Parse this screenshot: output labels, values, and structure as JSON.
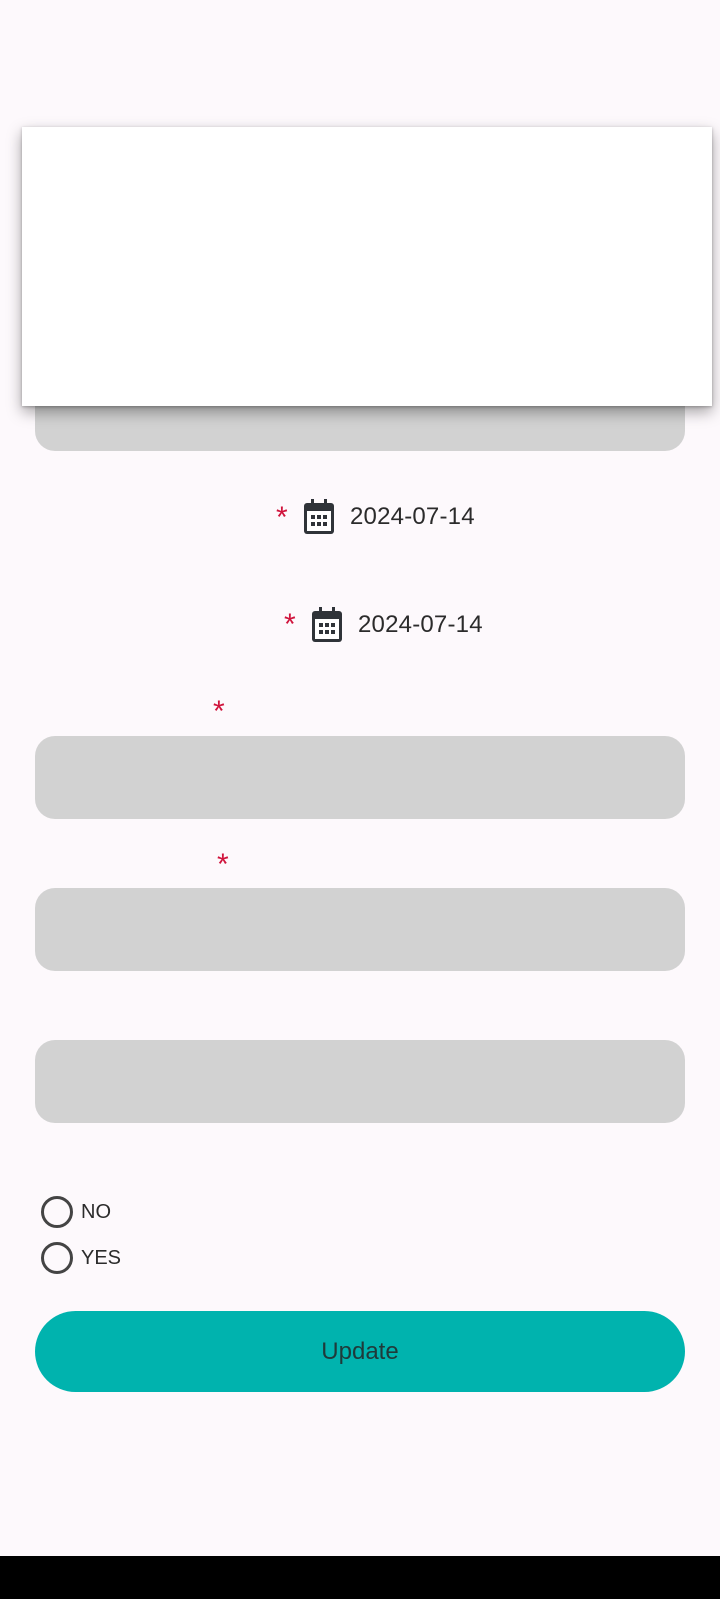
{
  "form": {
    "date_1": {
      "value": "2024-07-14",
      "required_mark": "*"
    },
    "date_2": {
      "value": "2024-07-14",
      "required_mark": "*"
    },
    "field_1": {
      "required_mark": "*"
    },
    "field_2": {
      "required_mark": "*"
    },
    "radio_options": [
      {
        "label": "NO"
      },
      {
        "label": "YES"
      }
    ],
    "update_label": "Update"
  },
  "icons": {
    "date": "calendar-icon"
  },
  "colors": {
    "required": "#d0143c",
    "button": "#00b3ae",
    "field": "#d2d2d2"
  }
}
